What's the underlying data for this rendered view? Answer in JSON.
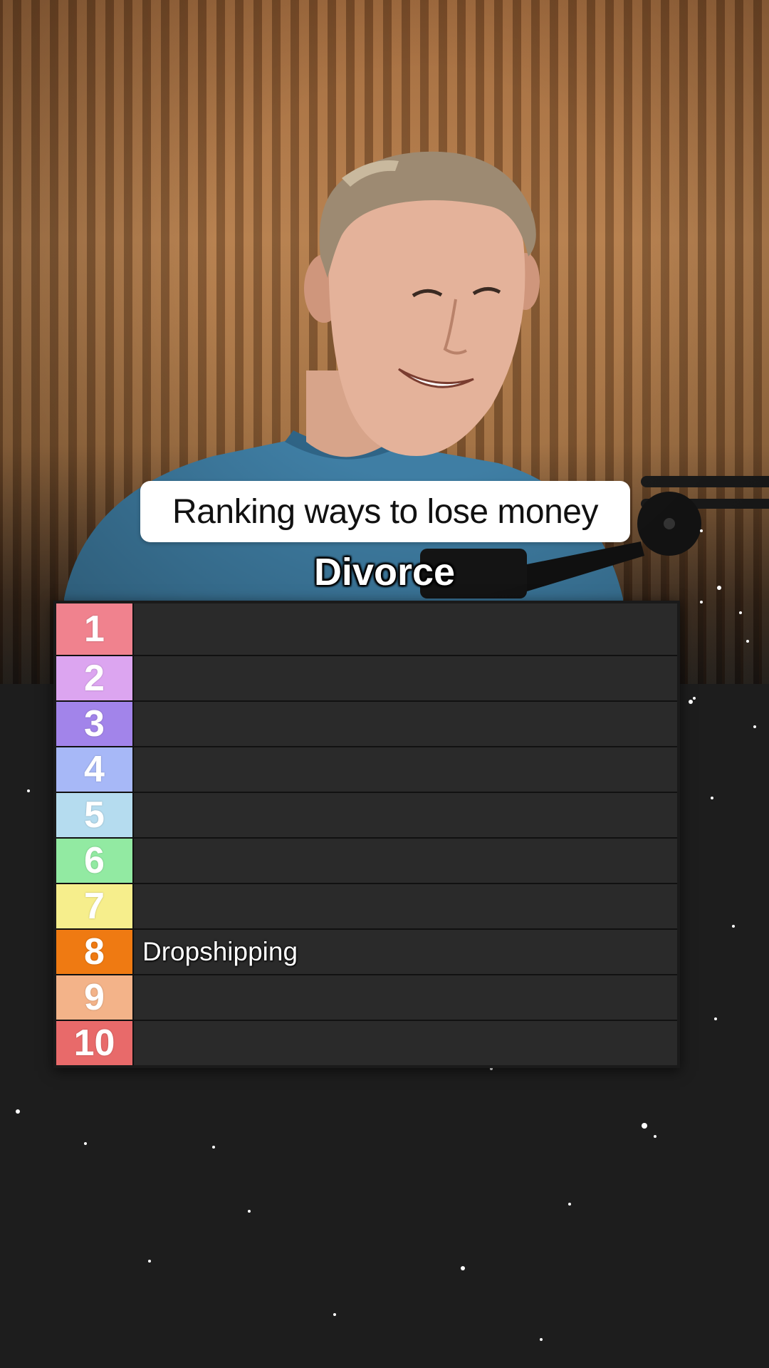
{
  "caption": {
    "text": "Ranking ways to lose money"
  },
  "current_item": {
    "text": "Divorce"
  },
  "tiers": [
    {
      "label": "1",
      "color": "#f0828e",
      "items": []
    },
    {
      "label": "2",
      "color": "#dca5f0",
      "items": []
    },
    {
      "label": "3",
      "color": "#a284ea",
      "items": []
    },
    {
      "label": "4",
      "color": "#a7b8f7",
      "items": []
    },
    {
      "label": "5",
      "color": "#b5dcef",
      "items": []
    },
    {
      "label": "6",
      "color": "#92eaa2",
      "items": []
    },
    {
      "label": "7",
      "color": "#f6ee8c",
      "items": []
    },
    {
      "label": "8",
      "color": "#ef7a12",
      "items": [
        "Dropshipping"
      ]
    },
    {
      "label": "9",
      "color": "#f3b389",
      "items": []
    },
    {
      "label": "10",
      "color": "#e86a6a",
      "items": []
    }
  ]
}
